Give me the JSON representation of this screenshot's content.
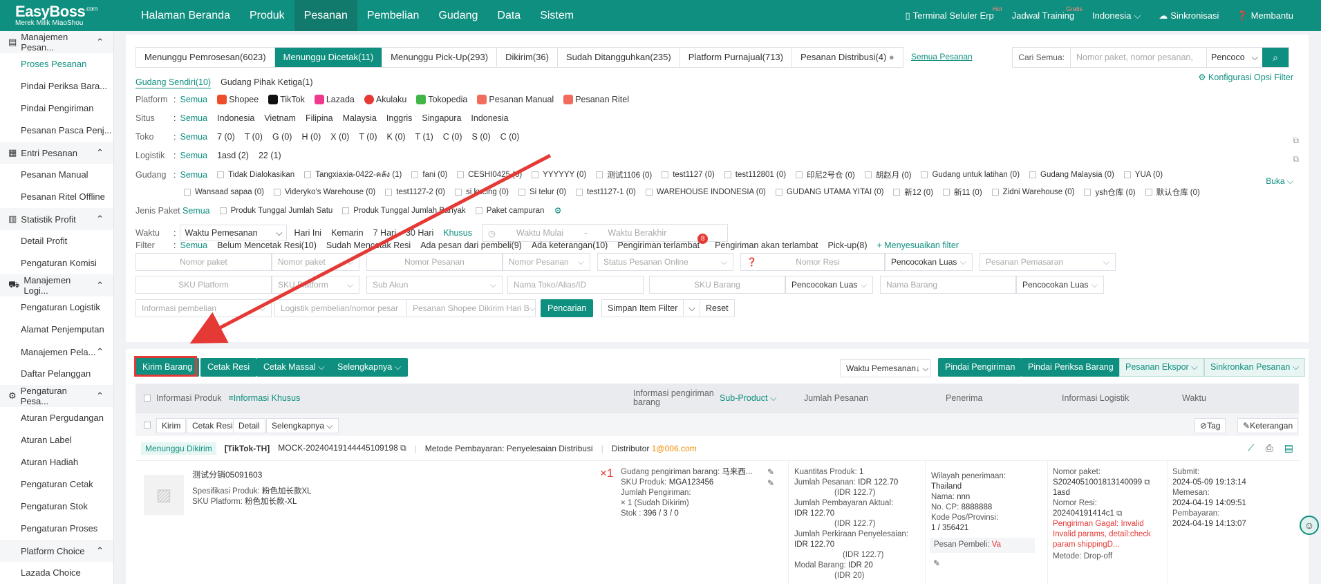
{
  "brand": {
    "name": "EasyBoss",
    "tld": ".com",
    "sub": "Merek Milik MiaoShou"
  },
  "topnav": [
    "Halaman Beranda",
    "Produk",
    "Pesanan",
    "Pembelian",
    "Gudang",
    "Data",
    "Sistem"
  ],
  "topright": {
    "terminal": "Terminal Seluler Erp",
    "terminal_sup": "Hot",
    "training": "Jadwal Training",
    "training_sup": "Gratis",
    "lang": "Indonesia",
    "sync": "Sinkronisasi",
    "help": "Membantu"
  },
  "sidebar": [
    {
      "group": "Manajemen Pesan...",
      "items": [
        "Proses Pesanan",
        "Pindai Periksa Bara...",
        "Pindai Pengiriman",
        "Pesanan Pasca Penj..."
      ]
    },
    {
      "group": "Entri Pesanan",
      "items": [
        "Pesanan Manual",
        "Pesanan Ritel Offline"
      ]
    },
    {
      "group": "Statistik Profit",
      "items": [
        "Detail Profit",
        "Pengaturan Komisi"
      ]
    },
    {
      "group": "Manajemen Logi...",
      "items": [
        "Pengaturan Logistik",
        "Alamat Penjemputan"
      ]
    },
    {
      "group": "Manajemen Pela...",
      "items": [
        "Daftar Pelanggan"
      ]
    },
    {
      "group": "Pengaturan Pesa...",
      "items": [
        "Aturan Pergudangan",
        "Aturan Label",
        "Aturan Hadiah",
        "Pengaturan Cetak",
        "Pengaturan Stok",
        "Pengaturan Proses"
      ]
    },
    {
      "group": "Platform Choice",
      "items": [
        "Lazada Choice"
      ]
    }
  ],
  "tabs": [
    "Menunggu Pemrosesan(6023)",
    "Menunggu Dicetak(11)",
    "Menunggu Pick-Up(293)",
    "Dikirim(36)",
    "Sudah Ditangguhkan(235)",
    "Platform Purnajual(713)",
    "Pesanan Distribusi(4)"
  ],
  "all_orders": "Semua Pesanan",
  "search": {
    "label": "Cari Semua:",
    "placeholder": "Nomor paket, nomor pesanan,",
    "mode": "Pencoco"
  },
  "warehouse_tabs": [
    "Gudang Sendiri(10)",
    "Gudang Pihak Ketiga(1)"
  ],
  "config_filter": "Konfigurasi Opsi Filter",
  "filters": {
    "platform": {
      "label": "Platform",
      "opts": [
        "Semua",
        "Shopee",
        "TikTok",
        "Lazada",
        "Akulaku",
        "Tokopedia",
        "Pesanan Manual",
        "Pesanan Ritel"
      ]
    },
    "situs": {
      "label": "Situs",
      "opts": [
        "Semua",
        "Indonesia",
        "Vietnam",
        "Filipina",
        "Malaysia",
        "Inggris",
        "Singapura",
        "Indonesia"
      ]
    },
    "toko": {
      "label": "Toko",
      "opts": [
        "Semua",
        "7 (0)",
        "T (0)",
        "G (0)",
        "H (0)",
        "X (0)",
        "T (0)",
        "K (0)",
        "T (1)",
        "C (0)",
        "S (0)",
        "C (0)"
      ]
    },
    "logistik": {
      "label": "Logistik",
      "opts": [
        "Semua",
        "1asd (2)",
        "22 (1)"
      ]
    },
    "gudang": {
      "label": "Gudang",
      "all": "Semua",
      "row1": [
        "Tidak Dialokasikan",
        "Tangxiaxia-0422-คลัง (1)",
        "fani (0)",
        "CESHI0425 (0)",
        "YYYYYY (0)",
        "测试1106 (0)",
        "test1127 (0)",
        "test112801 (0)",
        "印尼2号仓 (0)",
        "胡赵月 (0)",
        "Gudang untuk latihan (0)",
        "Gudang Malaysia (0)",
        "YUA (0)"
      ],
      "row2": [
        "Wansaad sapaa (0)",
        "Videryko's Warehouse (0)",
        "test1127-2 (0)",
        "si kucing (0)",
        "Si telur (0)",
        "test1127-1 (0)",
        "WAREHOUSE INDONESIA (0)",
        "GUDANG UTAMA YITAI (0)",
        "新12 (0)",
        "新11 (0)",
        "Zidni Warehouse (0)",
        "ysh仓库 (0)",
        "默认仓库 (0)"
      ],
      "open": "Buka"
    },
    "jenis": {
      "label": "Jenis Paket",
      "opts": [
        "Semua",
        "Produk Tunggal Jumlah Satu",
        "Produk Tunggal Jumlah Banyak",
        "Paket campuran"
      ]
    },
    "waktu": {
      "label": "Waktu",
      "select": "Waktu Pemesanan",
      "opts": [
        "Hari Ini",
        "Kemarin",
        "7 Hari",
        "30 Hari",
        "Khusus"
      ],
      "start": "Waktu Mulai",
      "end": "Waktu Berakhir"
    },
    "filter": {
      "label": "Filter",
      "opts": [
        "Semua",
        "Belum Mencetak Resi(10)",
        "Sudah Mencetak Resi",
        "Ada pesan dari pembeli(9)",
        "Ada keterangan(10)",
        "Pengiriman terlambat",
        "Pengiriman akan terlambat",
        "Pick-up(8)"
      ],
      "badge": "8",
      "customize": "+ Menyesuaikan filter"
    }
  },
  "inputs": {
    "r1": [
      "Nomor paket",
      "Nomor paket",
      "Nomor Pesanan",
      "Nomor Pesanan",
      "Status Pesanan Online",
      "Nomor Resi",
      "Pencocokan Luas",
      "Pesanan Pemasaran"
    ],
    "r2": [
      "SKU Platform",
      "SKU Platform",
      "Sub Akun",
      "Nama Toko/Alias/ID",
      "SKU Barang",
      "Pencocokan Luas",
      "Nama Barang",
      "Pencocokan Luas"
    ],
    "r3": [
      "Informasi pembelian",
      "Logistik pembelian/nomor pesar",
      "Pesanan Shopee Dikirim Hari B"
    ],
    "search_btn": "Pencarian",
    "save_filter": "Simpan Item Filter",
    "reset": "Reset"
  },
  "actions": {
    "kirim": "Kirim Barang",
    "cetak_resi": "Cetak Resi",
    "cetak_massal": "Cetak Massal",
    "more": "Selengkapnya",
    "sort": "Waktu Pemesanan↓",
    "scan_ship": "Pindai Pengiriman",
    "scan_check": "Pindai Periksa Barang",
    "export": "Pesanan Ekspor",
    "sync": "Sinkronkan Pesanan"
  },
  "table": {
    "headers": [
      "Informasi Produk",
      "Informasi Khusus",
      "Informasi pengiriman barang",
      "Sub-Product",
      "Jumlah Pesanan",
      "Penerima",
      "Informasi Logistik",
      "Waktu"
    ],
    "sub": [
      "Kirim",
      "Cetak Resi",
      "Detail",
      "Selengkapnya"
    ],
    "tag": "Tag",
    "note": "Keterangan"
  },
  "order": {
    "status": "Menunggu Dikirim",
    "platform": "[TikTok-TH]",
    "mock": "MOCK-20240419144445109198",
    "payment": "Metode Pembayaran: Penyelesaian Distribusi",
    "distributor_lbl": "Distributor",
    "distributor": "1@006.com",
    "product": {
      "name": "测试分销05091603",
      "spec_lbl": "Spesifikasi Produk:",
      "spec": "粉色加长款XL",
      "sku_lbl": "SKU Platform:",
      "sku": "粉色加长款-XL",
      "qty": "×1"
    },
    "ship": {
      "wh_lbl": "Gudang pengiriman barang:",
      "wh": "马来西...",
      "sku_lbl": "SKU Produk:",
      "sku": "MGA123456",
      "jml_lbl": "Jumlah Pengiriman:",
      "jml": "× 1 (Sudah Dikirim)",
      "stok_lbl": "Stok",
      "stok": "396 / 3 / 0"
    },
    "qty": {
      "k_lbl": "Kuantitas Produk:",
      "k": "1",
      "jp_lbl": "Jumlah Pesanan:",
      "jp": "IDR 122.70",
      "jp2": "(IDR 122.7)",
      "jpa_lbl": "Jumlah Pembayaran Aktual:",
      "jpa": "IDR 122.70",
      "jpa2": "(IDR 122.7)",
      "jps_lbl": "Jumlah Perkiraan Penyelesaian:",
      "jps": "IDR 122.70",
      "jps2": "(IDR 122.7)",
      "mb_lbl": "Modal Barang:",
      "mb": "IDR 20",
      "mb2": "(IDR 20)"
    },
    "recv": {
      "w_lbl": "Wilayah penerimaan:",
      "w": "Thailand",
      "n_lbl": "Nama:",
      "n": "nnn",
      "cp_lbl": "No. CP:",
      "cp": "8888888",
      "kp_lbl": "Kode Pos/Provinsi:",
      "kp": "1 / 356421",
      "pm_lbl": "Pesan Pembeli:",
      "pm": "Va"
    },
    "log": {
      "pk_lbl": "Nomor paket:",
      "pk": "S2024051001813140099",
      "pk2": "1asd",
      "nr_lbl": "Nomor Resi:",
      "nr": "202404191414c1",
      "err1": "Pengiriman Gagal: Invalid",
      "err2": "Invalid params, detail:check",
      "err3": "param shippingD...",
      "met": "Metode:  Drop-off"
    },
    "time": {
      "s_lbl": "Submit:",
      "s": "2024-05-09 19:13:14",
      "m_lbl": "Memesan:",
      "m": "2024-04-19 14:09:51",
      "p_lbl": "Pembayaran:",
      "p": "2024-04-19 14:13:07"
    }
  },
  "colors": {
    "brand": "#0f8f7f",
    "annotation": "#e53935"
  }
}
